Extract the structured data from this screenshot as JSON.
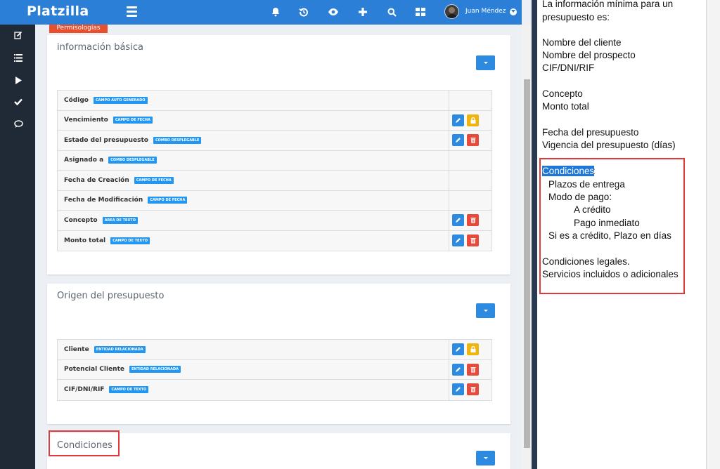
{
  "app": {
    "brand": "Platzilla",
    "user_name": "Juan Méndez"
  },
  "topbar": {
    "icons": [
      "menu-icon",
      "bell-icon",
      "history-icon",
      "eye-icon",
      "plus-icon",
      "search-icon",
      "grid-icon"
    ]
  },
  "sidebar": {
    "icons": [
      "edit-icon",
      "list-icon",
      "play-icon",
      "check-icon",
      "chat-icon"
    ]
  },
  "main": {
    "top_tag": "Permisologías",
    "sections": [
      {
        "title": "información básica",
        "fields": [
          {
            "name": "Código",
            "type": "CAMPO AUTO GENERADO",
            "actions": []
          },
          {
            "name": "Vencimiento",
            "type": "CAMPO DE FECHA",
            "actions": [
              "edit",
              "lock"
            ]
          },
          {
            "name": "Estado del presupuesto",
            "type": "COMBO DESPLEGABLE",
            "actions": [
              "edit",
              "delete"
            ]
          },
          {
            "name": "Asignado a",
            "type": "COMBO DESPLEGABLE",
            "actions": []
          },
          {
            "name": "Fecha de Creación",
            "type": "CAMPO DE FECHA",
            "actions": []
          },
          {
            "name": "Fecha de Modificación",
            "type": "CAMPO DE FECHA",
            "actions": []
          },
          {
            "name": "Concepto",
            "type": "ÁREA DE TEXTO",
            "actions": [
              "edit",
              "delete"
            ]
          },
          {
            "name": "Monto total",
            "type": "CAMPO DE TEXTO",
            "actions": [
              "edit",
              "delete"
            ]
          }
        ]
      },
      {
        "title": "Origen del presupuesto",
        "fields": [
          {
            "name": "Cliente",
            "type": "ENTIDAD RELACIONADA",
            "actions": [
              "edit",
              "lock"
            ]
          },
          {
            "name": "Potencial Cliente",
            "type": "ENTIDAD RELACIONADA",
            "actions": [
              "edit",
              "delete"
            ]
          },
          {
            "name": "CIF/DNI/RIF",
            "type": "CAMPO DE TEXTO",
            "actions": [
              "edit",
              "delete"
            ]
          }
        ]
      },
      {
        "title": "Condiciones",
        "fields": []
      }
    ]
  },
  "doc": {
    "lines": [
      "La información mínima para un",
      "presupuesto es:",
      "Nombre del cliente",
      "Nombre del prospecto",
      "CIF/DNI/RIF",
      "Concepto",
      "Monto total",
      "Fecha del presupuesto",
      "Vigencia del presupuesto (días)",
      "Condiciones",
      ":",
      "Plazos de entrega",
      "Modo de pago:",
      "A crédito",
      "Pago inmediato",
      "Si es a crédito, Plazo en días",
      "Condiciones legales.",
      "Servicios incluidos o adicionales"
    ]
  },
  "colors": {
    "topbar": "#2b7fd6",
    "sidebar": "#1f2a36",
    "badge": "#2196f3",
    "edit": "#2c8be0",
    "lock": "#f0b40f",
    "delete": "#e64a3b",
    "highlight_box": "#e0383b",
    "selection": "#1e77d6"
  }
}
